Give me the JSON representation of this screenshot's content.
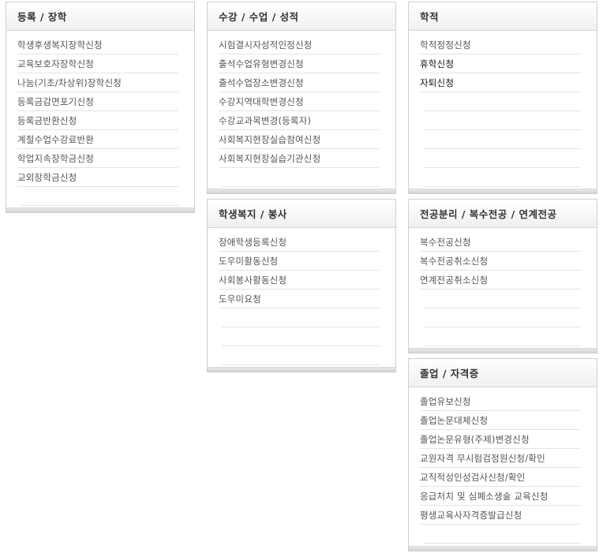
{
  "panels": [
    {
      "key": "reg",
      "title": "등록 / 장학",
      "items": [
        "학생후생복지장학신청",
        "교육보호자장학신청",
        "나눔(기초/차상위)장학신청",
        "등록금감면포기신청",
        "등록금반환신청",
        "계절수업수강료반환",
        "학업지속장학금신청",
        "교외장학금신청"
      ],
      "empty_rows": 1
    },
    {
      "key": "course",
      "title": "수강 / 수업 / 성적",
      "items": [
        "시험결시자성적인정신청",
        "출석수업유형변경신청",
        "출석수업장소변경신청",
        "수강지역대학변경신청",
        "수강교과목변경(등록자)",
        "사회복지현장실습참여신청",
        "사회복지현장실습기관신청"
      ],
      "empty_rows": 1
    },
    {
      "key": "record",
      "title": "학적",
      "items": [
        "학적정정신청",
        "휴학신청",
        "자퇴신청"
      ],
      "dark_items": [
        1,
        2
      ],
      "empty_rows": 5
    },
    {
      "key": "welfare",
      "title": "학생복지 / 봉사",
      "items": [
        "장애학생등록신청",
        "도우미활동신청",
        "사회봉사활동신청",
        "도우미요청"
      ],
      "empty_rows": 3
    },
    {
      "key": "major",
      "title": "전공분리 / 복수전공 / 연계전공",
      "items": [
        "복수전공신청",
        "복수전공취소신청",
        "연계전공취소신청"
      ],
      "empty_rows": 4
    },
    {
      "key": "grad",
      "title": "졸업 / 자격증",
      "items": [
        "졸업유보신청",
        "졸업논문대체신청",
        "졸업논문유형(주제)변경신청",
        "교원자격 무시험검정원신청/확인",
        "교직적성인성검사신청/확인",
        "응급처치 및 심폐소생술 교육신청",
        "평생교육사자격증발급신청"
      ],
      "empty_rows": 1
    }
  ]
}
